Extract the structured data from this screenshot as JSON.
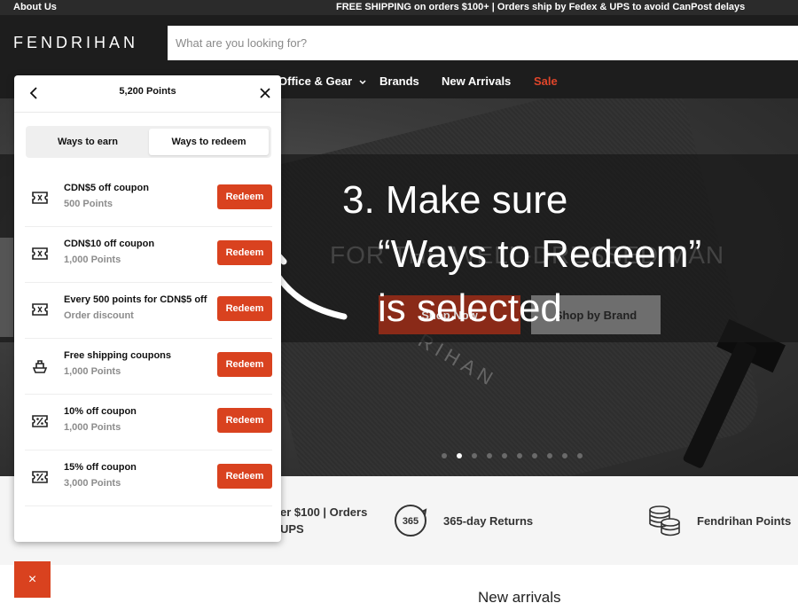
{
  "topbar": {
    "about": "About Us",
    "shipping": "FREE SHIPPING on orders $100+ | Orders ship by Fedex & UPS to avoid CanPost delays"
  },
  "header": {
    "logo": "FENDRIHAN",
    "search_placeholder": "What are you looking for?"
  },
  "nav": {
    "items": [
      {
        "label": "Office & Gear",
        "has_dropdown": true
      },
      {
        "label": "Brands"
      },
      {
        "label": "New Arrivals"
      },
      {
        "label": "Sale"
      }
    ],
    "sale_color": "#e0452a"
  },
  "hero": {
    "headline": "FOR THE WELL-DRESSED MAN",
    "button_dark": "Shop Now",
    "button_light": "Shop by Brand",
    "brand_mark": "RIHAN",
    "slide_count": 10,
    "active_slide": 2
  },
  "callout": {
    "line1": "3. Make sure",
    "line2": "“Ways to Redeem”",
    "line3": "is selected"
  },
  "features": {
    "shipping_text_line1": "er $100 | Orders",
    "shipping_text_line2": "UPS",
    "returns_badge": "365",
    "returns_text": "365-day Returns",
    "points_text": "Fendrihan Points"
  },
  "section": {
    "new_arrivals": "New arrivals"
  },
  "popup": {
    "title": "5,200 Points",
    "tabs": [
      {
        "label": "Ways to earn",
        "selected": false
      },
      {
        "label": "Ways to redeem",
        "selected": true
      }
    ],
    "redeem_label": "Redeem",
    "rewards": [
      {
        "title": "CDN$5 off coupon",
        "subtitle": "500 Points",
        "icon": "coupon-icon"
      },
      {
        "title": "CDN$10 off coupon",
        "subtitle": "1,000 Points",
        "icon": "coupon-icon"
      },
      {
        "title": "Every 500 points for CDN$5 off",
        "subtitle": "Order discount",
        "icon": "coupon-icon"
      },
      {
        "title": "Free shipping coupons",
        "subtitle": "1,000 Points",
        "icon": "shipping-icon"
      },
      {
        "title": "10% off coupon",
        "subtitle": "1,000 Points",
        "icon": "percent-coupon-icon"
      },
      {
        "title": "15% off coupon",
        "subtitle": "3,000 Points",
        "icon": "percent-coupon-icon"
      }
    ]
  },
  "launcher": {
    "label": "×"
  },
  "colors": {
    "accent": "#d9421f",
    "header_bg": "#1d1d1d"
  }
}
